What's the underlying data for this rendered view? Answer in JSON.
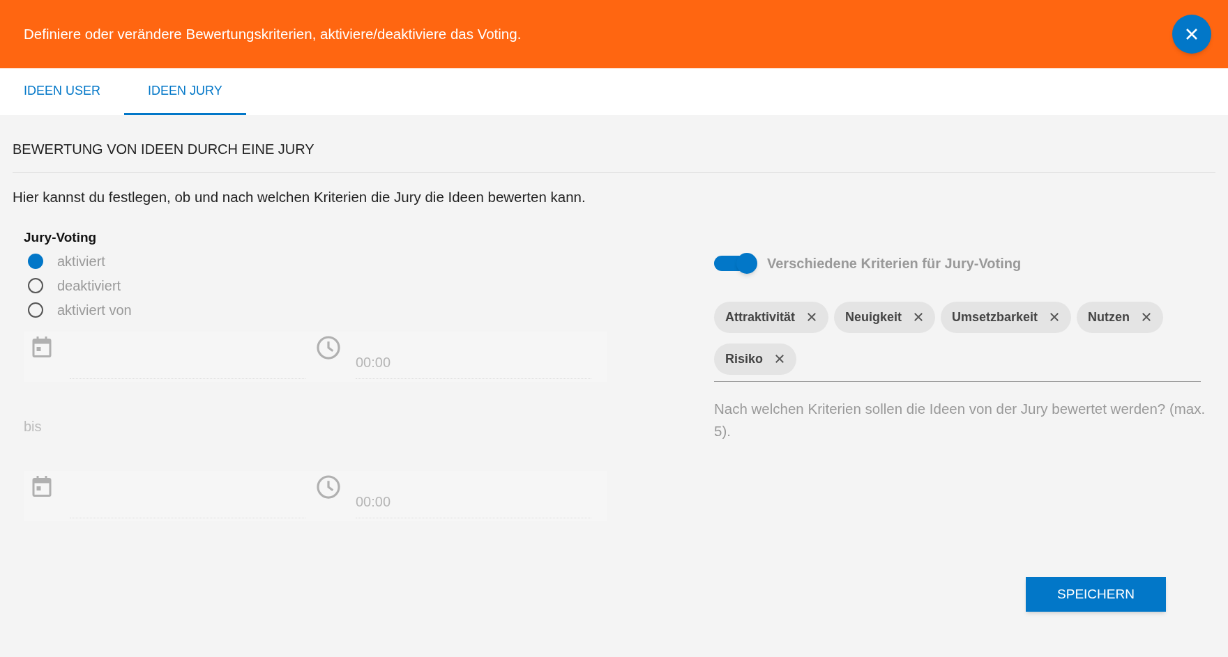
{
  "banner": {
    "text": "Definiere oder verändere Bewertungskriterien, aktiviere/deaktiviere das Voting."
  },
  "tabs": [
    {
      "label": "IDEEN USER",
      "selected": false
    },
    {
      "label": "IDEEN JURY",
      "selected": true
    }
  ],
  "section": {
    "title": "BEWERTUNG VON IDEEN DURCH EINE JURY",
    "description": "Hier kannst du festlegen, ob und nach welchen Kriterien die Jury die Ideen bewerten kann."
  },
  "jury_voting": {
    "label": "Jury-Voting",
    "options": [
      {
        "label": "aktiviert",
        "selected": true
      },
      {
        "label": "deaktiviert",
        "selected": false
      },
      {
        "label": "aktiviert von",
        "selected": false
      }
    ]
  },
  "date_range": {
    "disabled": true,
    "from_time_placeholder": "00:00",
    "separator": "bis",
    "to_time_placeholder": "00:00"
  },
  "criteria_toggle": {
    "label": "Verschiedene Kriterien für Jury-Voting",
    "on": true
  },
  "criteria": [
    "Attraktivität",
    "Neuigkeit",
    "Umsetzbarkeit",
    "Nutzen",
    "Risiko"
  ],
  "criteria_hint": "Nach welchen Kriterien sollen die Ideen von der Jury bewertet werden? (max. 5).",
  "save_button": "SPEICHERN"
}
